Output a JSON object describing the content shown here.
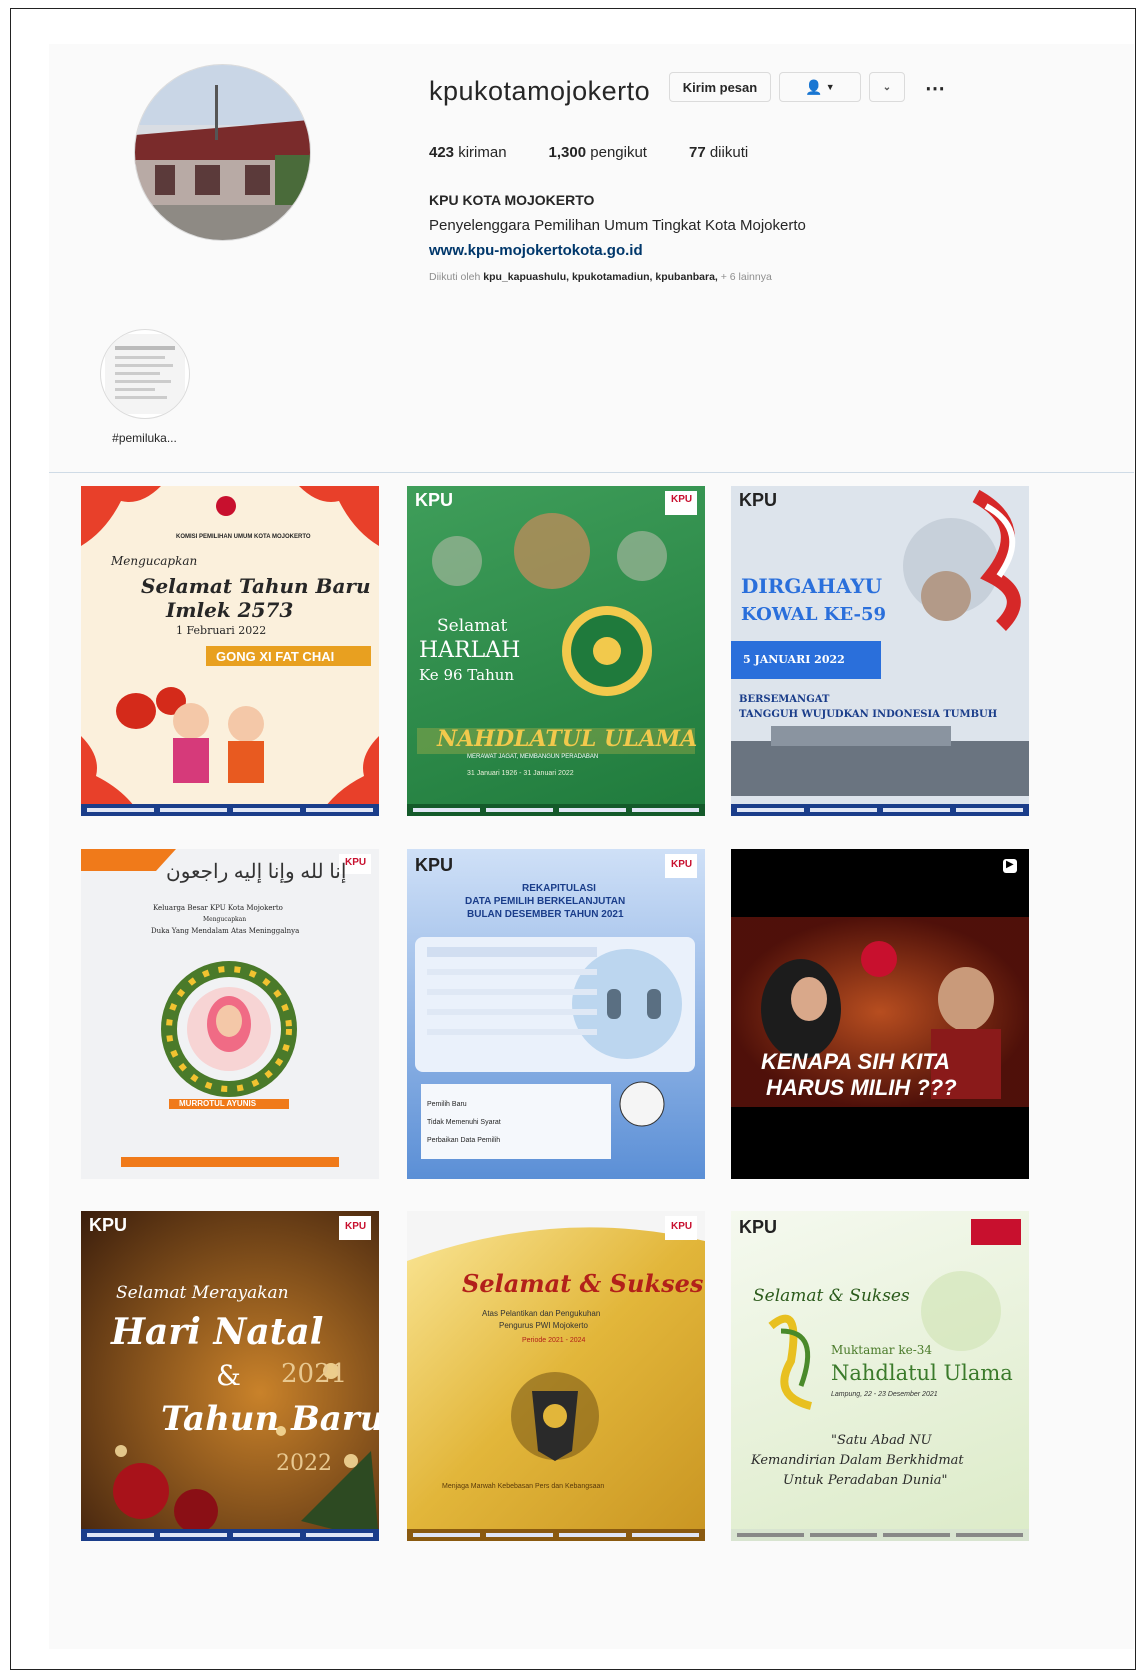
{
  "profile": {
    "username": "kpukotamojokerto",
    "message_button": "Kirim pesan",
    "follow_icon": "person-icon",
    "posts_count": "423",
    "posts_label": "kiriman",
    "followers_count": "1,300",
    "followers_label": "pengikut",
    "following_count": "77",
    "following_label": "diikuti",
    "full_name": "KPU KOTA MOJOKERTO",
    "bio": "Penyelenggara Pemilihan Umum Tingkat Kota Mojokerto",
    "website": "www.kpu-mojokertokota.go.id",
    "followed_by_prefix": "Diikuti oleh",
    "followed_by_accounts": "kpu_kapuashulu, kpukotamadiun, kpubanbara,",
    "followed_by_more": "+ 6 lainnya"
  },
  "highlight": {
    "label": "#pemiluka..."
  },
  "posts": {
    "p1": {
      "greeting": "Mengucapkan",
      "line1": "Selamat Tahun Baru",
      "line2": "Imlek 2573",
      "date": "1 Februari 2022",
      "banner": "GONG XI FAT CHAI",
      "org": "KOMISI PEMILIHAN UMUM KOTA MOJOKERTO"
    },
    "p2": {
      "logo": "KPU",
      "l1": "Selamat",
      "l2": "HARLAH",
      "l3": "Ke 96 Tahun",
      "banner": "NAHDLATUL ULAMA",
      "sub": "MERAWAT JAGAT, MEMBANGUN PERADABAN",
      "dates": "31 Januari 1926 - 31 Januari 2022"
    },
    "p3": {
      "logo": "KPU",
      "l1": "DIRGAHAYU",
      "l2": "KOWAL KE-59",
      "date": "5 JANUARI 2022",
      "l3": "BERSEMANGAT",
      "l4": "TANGGUH WUJUDKAN INDONESIA TUMBUH"
    },
    "p4": {
      "arabic": "إنا لله وإنا إليه راجعون",
      "l1": "Keluarga Besar KPU Kota Mojokerto",
      "l2": "Mengucapkan",
      "l3": "Duka Yang Mendalam Atas Meninggalnya",
      "name": "MURROTUL AYUNIS"
    },
    "p5": {
      "logo": "KPU",
      "title1": "REKAPITULASI",
      "title2": "DATA PEMILIH BERKELANJUTAN",
      "title3": "BULAN DESEMBER TAHUN 2021",
      "row1": "Pemilih Baru",
      "row2": "Tidak Memenuhi Syarat",
      "row3": "Perbaikan Data Pemilih"
    },
    "p6": {
      "l1": "KENAPA SIH KITA",
      "l2": "HARUS MILIH ???"
    },
    "p7": {
      "logo": "KPU",
      "l1": "Selamat Merayakan",
      "l2": "Hari Natal",
      "l3": "&",
      "year": "2021",
      "l4": "Tahun Baru",
      "year2": "2022"
    },
    "p8": {
      "l1": "Selamat & Sukses",
      "l2": "Atas Pelantikan dan Pengukuhan",
      "l3": "Pengurus PWI Mojokerto",
      "l4": "Periode 2021 - 2024",
      "footer": "Menjaga Marwah Kebebasan Pers dan Kebangsaan"
    },
    "p9": {
      "logo": "KPU",
      "l1": "Selamat & Sukses",
      "l2": "Muktamar ke-34",
      "l3": "Nahdlatul Ulama",
      "l4": "Lampung, 22 - 23 Desember 2021",
      "q1": "\"Satu Abad NU",
      "q2": "Kemandirian Dalam Berkhidmat",
      "q3": "Untuk Peradaban Dunia\""
    }
  },
  "colors": {
    "link": "#00376b",
    "kpu_red": "#c8102e",
    "text": "#262626"
  }
}
